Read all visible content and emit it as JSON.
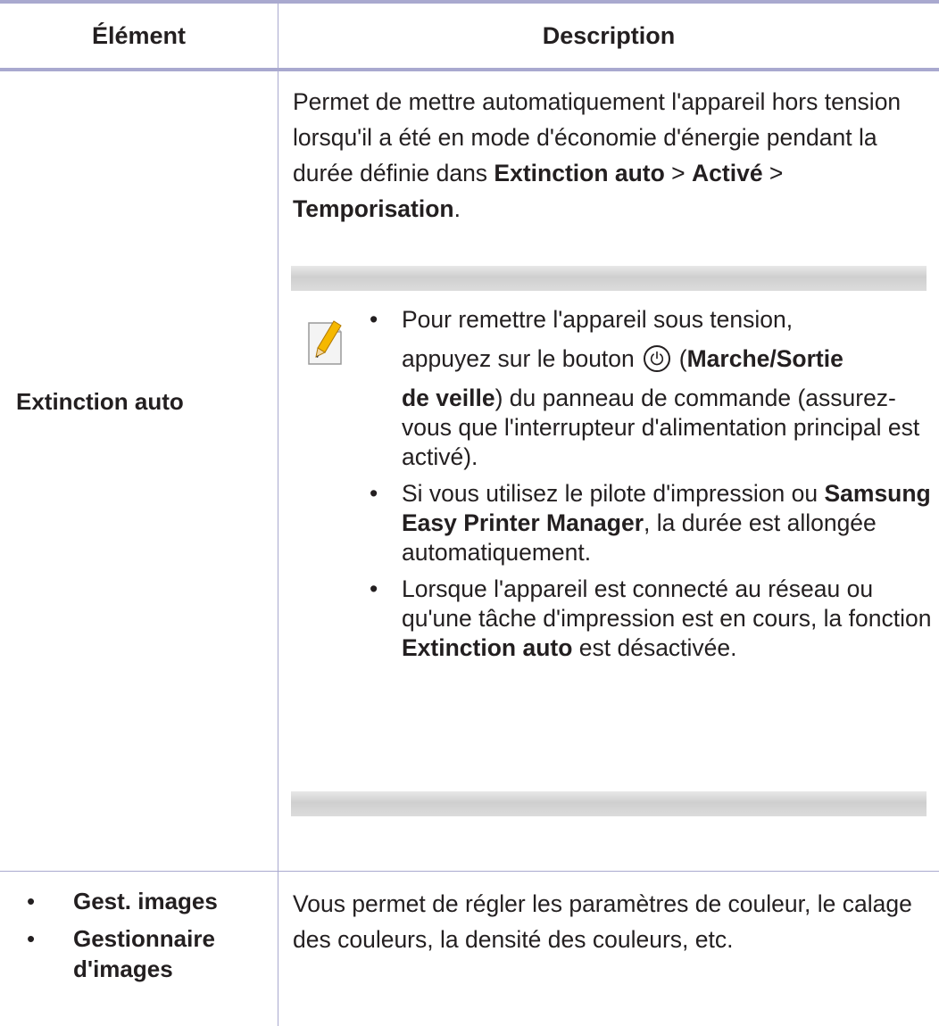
{
  "colors": {
    "rule": "#a9a9cf",
    "text": "#231f20",
    "note_bar": "#d6d6d6"
  },
  "header": {
    "col1": "Élément",
    "col2": "Description"
  },
  "row1": {
    "item": "Extinction auto",
    "desc": {
      "part1": "Permet de mettre automatiquement l'appareil hors tension lorsqu'il a été en mode d'économie d'énergie pendant la durée définie dans ",
      "bold1": "Extinction auto",
      "sep1": " > ",
      "bold2": "Activé",
      "sep2": " > ",
      "bold3": "Temporisation",
      "end": "."
    },
    "note": {
      "icon": "note-pencil-icon",
      "bullet": "•",
      "item1": {
        "line1": "Pour remettre l'appareil sous tension,",
        "line2_pre": "appuyez sur le bouton",
        "power_icon": "power-icon",
        "line2_paren_open": "(",
        "line2_bold": "Marche/Sortie",
        "line3_bold": "de veille",
        "line3_rest": ") du panneau de commande (assurez-vous que l'interrupteur d'alimentation principal est activé)."
      },
      "item2": {
        "pre": "Si vous utilisez le pilote d'impression ou ",
        "bold": "Samsung Easy Printer Manager",
        "post": ", la durée est allongée automatiquement."
      },
      "item3": {
        "pre": "Lorsque l'appareil est connecté au réseau ou qu'une tâche d'impression est en cours, la fonction ",
        "bold": "Extinction auto",
        "post": " est désactivée."
      }
    }
  },
  "row2": {
    "bullet": "•",
    "items": [
      "Gest. images",
      "Gestionnaire d'images"
    ],
    "desc": "Vous permet de régler les paramètres de couleur, le calage des couleurs, la densité des couleurs, etc."
  }
}
